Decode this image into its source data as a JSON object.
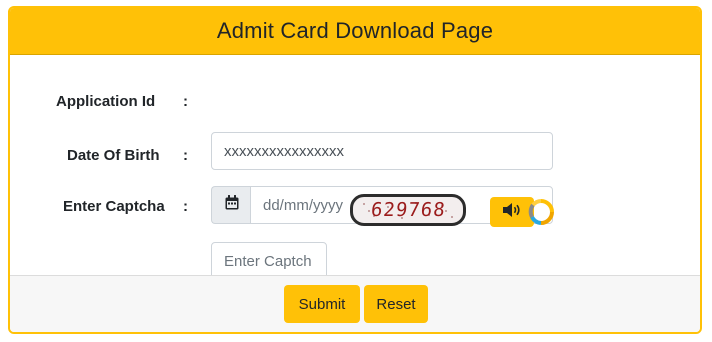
{
  "header": {
    "title": "Admit Card Download Page"
  },
  "form": {
    "application_id": {
      "label": "Application Id",
      "colon": ":",
      "value": "xxxxxxxxxxxxxxxx"
    },
    "dob": {
      "label": "Date Of Birth",
      "colon": ":",
      "placeholder": "dd/mm/yyyy",
      "icon": "calendar-icon"
    },
    "captcha": {
      "label": "Enter Captcha",
      "colon": ":",
      "placeholder": "Enter Captch",
      "code": "629768",
      "audio_icon": "speaker-icon",
      "refresh_icon": "refresh-icon"
    }
  },
  "footer": {
    "submit_label": "Submit",
    "reset_label": "Reset"
  },
  "colors": {
    "accent": "#ffc107",
    "captcha_text": "#9b1c1c"
  }
}
